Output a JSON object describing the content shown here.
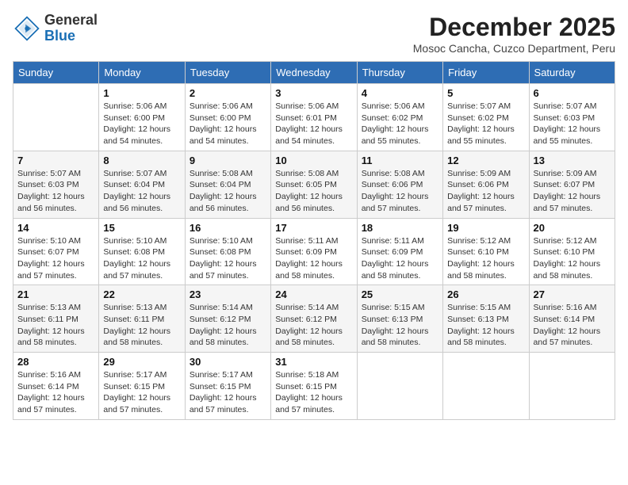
{
  "logo": {
    "general": "General",
    "blue": "Blue"
  },
  "header": {
    "month": "December 2025",
    "location": "Mosoc Cancha, Cuzco Department, Peru"
  },
  "days_of_week": [
    "Sunday",
    "Monday",
    "Tuesday",
    "Wednesday",
    "Thursday",
    "Friday",
    "Saturday"
  ],
  "weeks": [
    [
      {
        "day": "",
        "info": ""
      },
      {
        "day": "1",
        "info": "Sunrise: 5:06 AM\nSunset: 6:00 PM\nDaylight: 12 hours\nand 54 minutes."
      },
      {
        "day": "2",
        "info": "Sunrise: 5:06 AM\nSunset: 6:00 PM\nDaylight: 12 hours\nand 54 minutes."
      },
      {
        "day": "3",
        "info": "Sunrise: 5:06 AM\nSunset: 6:01 PM\nDaylight: 12 hours\nand 54 minutes."
      },
      {
        "day": "4",
        "info": "Sunrise: 5:06 AM\nSunset: 6:02 PM\nDaylight: 12 hours\nand 55 minutes."
      },
      {
        "day": "5",
        "info": "Sunrise: 5:07 AM\nSunset: 6:02 PM\nDaylight: 12 hours\nand 55 minutes."
      },
      {
        "day": "6",
        "info": "Sunrise: 5:07 AM\nSunset: 6:03 PM\nDaylight: 12 hours\nand 55 minutes."
      }
    ],
    [
      {
        "day": "7",
        "info": "Sunrise: 5:07 AM\nSunset: 6:03 PM\nDaylight: 12 hours\nand 56 minutes."
      },
      {
        "day": "8",
        "info": "Sunrise: 5:07 AM\nSunset: 6:04 PM\nDaylight: 12 hours\nand 56 minutes."
      },
      {
        "day": "9",
        "info": "Sunrise: 5:08 AM\nSunset: 6:04 PM\nDaylight: 12 hours\nand 56 minutes."
      },
      {
        "day": "10",
        "info": "Sunrise: 5:08 AM\nSunset: 6:05 PM\nDaylight: 12 hours\nand 56 minutes."
      },
      {
        "day": "11",
        "info": "Sunrise: 5:08 AM\nSunset: 6:06 PM\nDaylight: 12 hours\nand 57 minutes."
      },
      {
        "day": "12",
        "info": "Sunrise: 5:09 AM\nSunset: 6:06 PM\nDaylight: 12 hours\nand 57 minutes."
      },
      {
        "day": "13",
        "info": "Sunrise: 5:09 AM\nSunset: 6:07 PM\nDaylight: 12 hours\nand 57 minutes."
      }
    ],
    [
      {
        "day": "14",
        "info": "Sunrise: 5:10 AM\nSunset: 6:07 PM\nDaylight: 12 hours\nand 57 minutes."
      },
      {
        "day": "15",
        "info": "Sunrise: 5:10 AM\nSunset: 6:08 PM\nDaylight: 12 hours\nand 57 minutes."
      },
      {
        "day": "16",
        "info": "Sunrise: 5:10 AM\nSunset: 6:08 PM\nDaylight: 12 hours\nand 57 minutes."
      },
      {
        "day": "17",
        "info": "Sunrise: 5:11 AM\nSunset: 6:09 PM\nDaylight: 12 hours\nand 58 minutes."
      },
      {
        "day": "18",
        "info": "Sunrise: 5:11 AM\nSunset: 6:09 PM\nDaylight: 12 hours\nand 58 minutes."
      },
      {
        "day": "19",
        "info": "Sunrise: 5:12 AM\nSunset: 6:10 PM\nDaylight: 12 hours\nand 58 minutes."
      },
      {
        "day": "20",
        "info": "Sunrise: 5:12 AM\nSunset: 6:10 PM\nDaylight: 12 hours\nand 58 minutes."
      }
    ],
    [
      {
        "day": "21",
        "info": "Sunrise: 5:13 AM\nSunset: 6:11 PM\nDaylight: 12 hours\nand 58 minutes."
      },
      {
        "day": "22",
        "info": "Sunrise: 5:13 AM\nSunset: 6:11 PM\nDaylight: 12 hours\nand 58 minutes."
      },
      {
        "day": "23",
        "info": "Sunrise: 5:14 AM\nSunset: 6:12 PM\nDaylight: 12 hours\nand 58 minutes."
      },
      {
        "day": "24",
        "info": "Sunrise: 5:14 AM\nSunset: 6:12 PM\nDaylight: 12 hours\nand 58 minutes."
      },
      {
        "day": "25",
        "info": "Sunrise: 5:15 AM\nSunset: 6:13 PM\nDaylight: 12 hours\nand 58 minutes."
      },
      {
        "day": "26",
        "info": "Sunrise: 5:15 AM\nSunset: 6:13 PM\nDaylight: 12 hours\nand 58 minutes."
      },
      {
        "day": "27",
        "info": "Sunrise: 5:16 AM\nSunset: 6:14 PM\nDaylight: 12 hours\nand 57 minutes."
      }
    ],
    [
      {
        "day": "28",
        "info": "Sunrise: 5:16 AM\nSunset: 6:14 PM\nDaylight: 12 hours\nand 57 minutes."
      },
      {
        "day": "29",
        "info": "Sunrise: 5:17 AM\nSunset: 6:15 PM\nDaylight: 12 hours\nand 57 minutes."
      },
      {
        "day": "30",
        "info": "Sunrise: 5:17 AM\nSunset: 6:15 PM\nDaylight: 12 hours\nand 57 minutes."
      },
      {
        "day": "31",
        "info": "Sunrise: 5:18 AM\nSunset: 6:15 PM\nDaylight: 12 hours\nand 57 minutes."
      },
      {
        "day": "",
        "info": ""
      },
      {
        "day": "",
        "info": ""
      },
      {
        "day": "",
        "info": ""
      }
    ]
  ]
}
